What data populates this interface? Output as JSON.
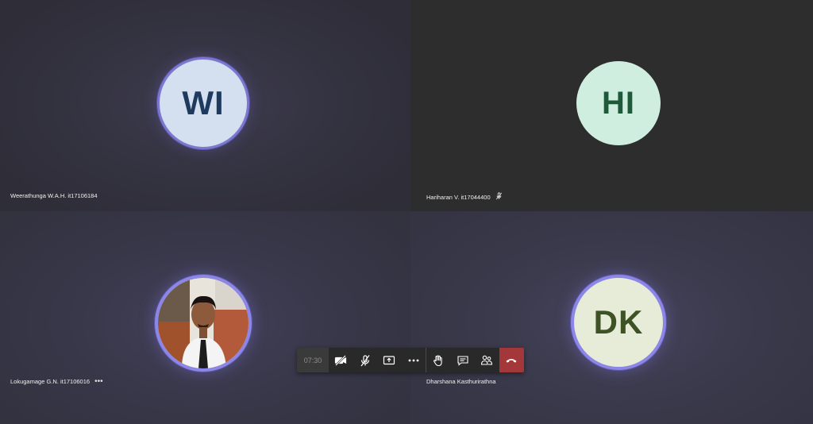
{
  "participants": [
    {
      "name": "Weerathunga W.A.H. it17106184",
      "initials": "WI",
      "avatar_bg": "#d4dff0",
      "avatar_fg": "#1e3a5e",
      "speaking": true
    },
    {
      "name": "Hariharan V. it17044400",
      "initials": "HI",
      "avatar_bg": "#cfeee0",
      "avatar_fg": "#1e5a3a",
      "muted": true
    },
    {
      "name": "Lokugamage G.N. it17106016",
      "photo": "profile-photo",
      "speaking": true
    },
    {
      "name": "Dharshana Kasthurirathna",
      "initials": "DK",
      "avatar_bg": "#e6ecd8",
      "avatar_fg": "#3e5226",
      "speaking": true
    }
  ],
  "toolbar": {
    "timer": "07:30",
    "buttons": [
      "camera-off-icon",
      "mic-off-icon",
      "share-screen-icon",
      "more-options-icon",
      "raise-hand-icon",
      "chat-icon",
      "participants-icon",
      "hang-up-icon"
    ],
    "hangup_color": "#a4373a"
  },
  "colors": {
    "speaking_ring": "#8c86e6"
  }
}
